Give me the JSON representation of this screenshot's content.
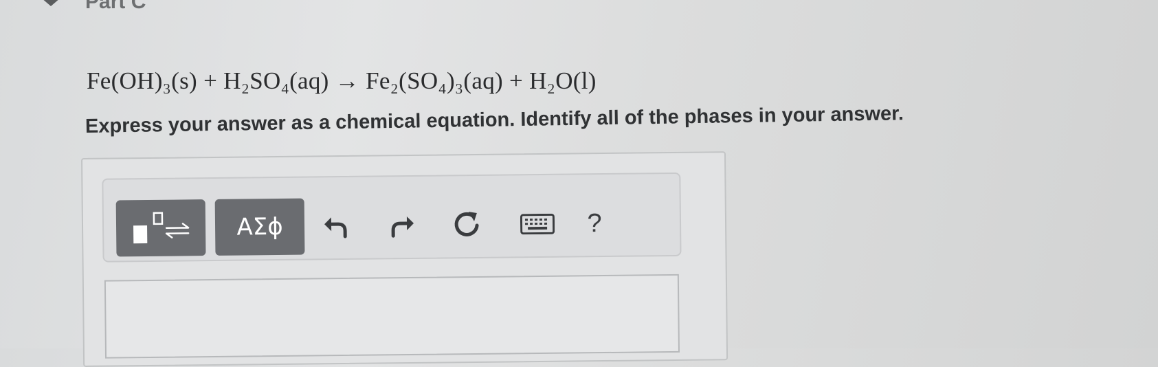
{
  "part": {
    "label": "Part C"
  },
  "equation": {
    "reactant1": "Fe(OH)₃(s)",
    "plus1": "+",
    "reactant2": "H₂SO₄(aq)",
    "arrow": "→",
    "product1": "Fe₂(SO₄)₃(aq)",
    "plus2": "+",
    "product2": "H₂O(l)"
  },
  "instruction": "Express your answer as a chemical equation. Identify all of the phases in your answer.",
  "toolbar": {
    "greek_label": "ΑΣϕ",
    "help_label": "?",
    "icons": [
      "templates-icon",
      "undo-icon",
      "redo-icon",
      "reset-icon",
      "keyboard-icon"
    ]
  },
  "answer_input": {
    "value": ""
  },
  "colors": {
    "dark_button": "#6a6c70",
    "background": "#e0e1e2"
  }
}
